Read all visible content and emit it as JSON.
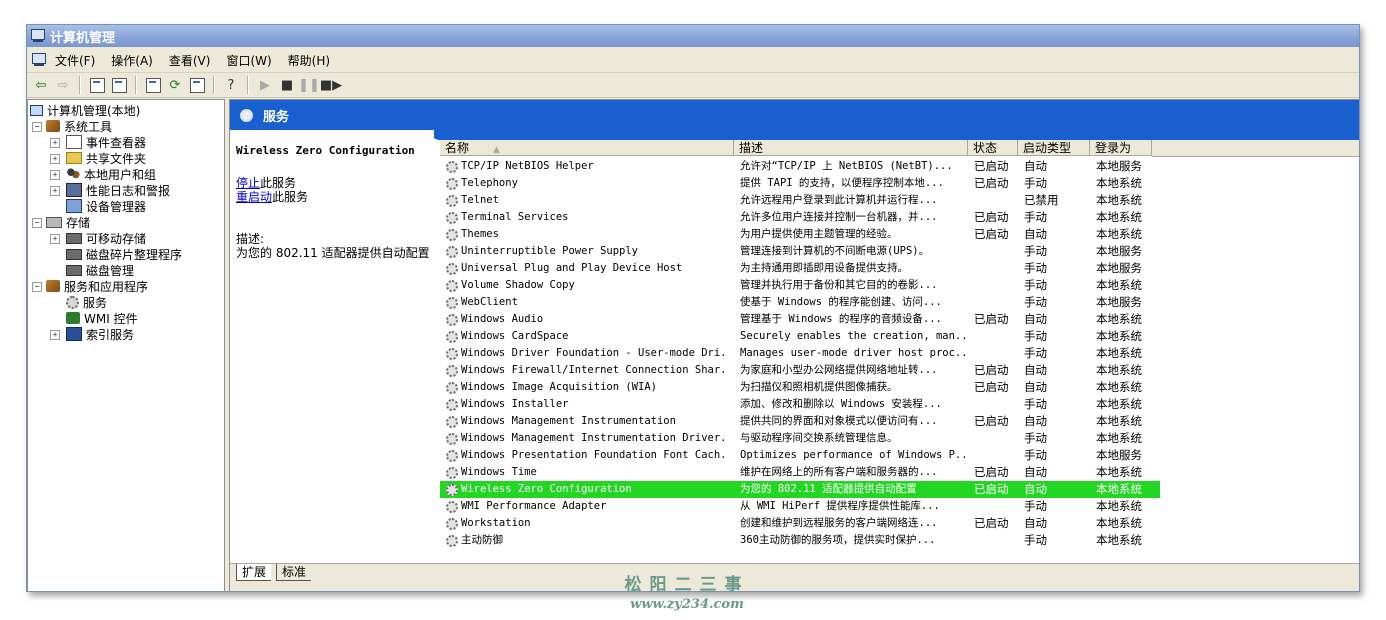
{
  "window": {
    "title": "计算机管理"
  },
  "menubar": [
    "文件(F)",
    "操作(A)",
    "查看(V)",
    "窗口(W)",
    "帮助(H)"
  ],
  "toolbar": {
    "icons": [
      "back-arrow-icon",
      "forward-arrow-icon",
      "up-folder-icon",
      "show-tree-icon",
      "properties-icon",
      "refresh-icon",
      "export-icon",
      "help-icon",
      "play-icon",
      "stop-icon",
      "pause-icon",
      "restart-icon"
    ]
  },
  "tree": {
    "root": "计算机管理(本地)",
    "system_tools": "系统工具",
    "event_viewer": "事件查看器",
    "shared_folders": "共享文件夹",
    "local_users": "本地用户和组",
    "perf_logs": "性能日志和警报",
    "device_manager": "设备管理器",
    "storage": "存储",
    "removable_storage": "可移动存储",
    "defrag": "磁盘碎片整理程序",
    "disk_mgmt": "磁盘管理",
    "services_apps": "服务和应用程序",
    "services": "服务",
    "wmi": "WMI 控件",
    "indexing": "索引服务"
  },
  "services_panel": {
    "header": "服务",
    "detail": {
      "title": "Wireless Zero Configuration",
      "stop_link": "停止",
      "stop_text": "此服务",
      "restart_link": "重启动",
      "restart_text": "此服务",
      "desc_label": "描述:",
      "desc_text": "为您的 802.11 适配器提供自动配置"
    },
    "columns": {
      "name": "名称",
      "desc": "描述",
      "status": "状态",
      "startup": "启动类型",
      "logon": "登录为"
    },
    "rows": [
      {
        "name": "TCP/IP NetBIOS Helper",
        "desc": "允许对“TCP/IP 上 NetBIOS (NetBT)...",
        "status": "已启动",
        "startup": "自动",
        "logon": "本地服务"
      },
      {
        "name": "Telephony",
        "desc": "提供 TAPI 的支持，以便程序控制本地...",
        "status": "已启动",
        "startup": "手动",
        "logon": "本地系统"
      },
      {
        "name": "Telnet",
        "desc": "允许远程用户登录到此计算机并运行程...",
        "status": "",
        "startup": "已禁用",
        "logon": "本地系统"
      },
      {
        "name": "Terminal Services",
        "desc": "允许多位用户连接并控制一台机器，并...",
        "status": "已启动",
        "startup": "手动",
        "logon": "本地系统"
      },
      {
        "name": "Themes",
        "desc": "为用户提供使用主题管理的经验。",
        "status": "已启动",
        "startup": "自动",
        "logon": "本地系统"
      },
      {
        "name": "Uninterruptible Power Supply",
        "desc": "管理连接到计算机的不间断电源(UPS)。",
        "status": "",
        "startup": "手动",
        "logon": "本地服务"
      },
      {
        "name": "Universal Plug and Play Device Host",
        "desc": "为主持通用即插即用设备提供支持。",
        "status": "",
        "startup": "手动",
        "logon": "本地服务"
      },
      {
        "name": "Volume Shadow Copy",
        "desc": "管理并执行用于备份和其它目的的卷影...",
        "status": "",
        "startup": "手动",
        "logon": "本地系统"
      },
      {
        "name": "WebClient",
        "desc": "使基于 Windows 的程序能创建、访问...",
        "status": "",
        "startup": "手动",
        "logon": "本地服务"
      },
      {
        "name": "Windows Audio",
        "desc": "管理基于 Windows 的程序的音频设备...",
        "status": "已启动",
        "startup": "自动",
        "logon": "本地系统"
      },
      {
        "name": "Windows CardSpace",
        "desc": "Securely enables the creation, man...",
        "status": "",
        "startup": "手动",
        "logon": "本地系统"
      },
      {
        "name": "Windows Driver Foundation - User-mode Dri...",
        "desc": "Manages user-mode driver host proc...",
        "status": "",
        "startup": "手动",
        "logon": "本地系统"
      },
      {
        "name": "Windows Firewall/Internet Connection Shar...",
        "desc": "为家庭和小型办公网络提供网络地址转...",
        "status": "已启动",
        "startup": "自动",
        "logon": "本地系统"
      },
      {
        "name": "Windows Image Acquisition (WIA)",
        "desc": "为扫描仪和照相机提供图像捕获。",
        "status": "已启动",
        "startup": "自动",
        "logon": "本地系统"
      },
      {
        "name": "Windows Installer",
        "desc": "添加、修改和删除以 Windows 安装程...",
        "status": "",
        "startup": "手动",
        "logon": "本地系统"
      },
      {
        "name": "Windows Management Instrumentation",
        "desc": "提供共同的界面和对象模式以便访问有...",
        "status": "已启动",
        "startup": "自动",
        "logon": "本地系统"
      },
      {
        "name": "Windows Management Instrumentation Driver...",
        "desc": "与驱动程序间交换系统管理信息。",
        "status": "",
        "startup": "手动",
        "logon": "本地系统"
      },
      {
        "name": "Windows Presentation Foundation Font Cach...",
        "desc": "Optimizes performance of Windows P...",
        "status": "",
        "startup": "手动",
        "logon": "本地服务"
      },
      {
        "name": "Windows Time",
        "desc": "维护在网络上的所有客户端和服务器的...",
        "status": "已启动",
        "startup": "自动",
        "logon": "本地系统"
      },
      {
        "name": "Wireless Zero Configuration",
        "desc": "为您的 802.11 适配器提供自动配置",
        "status": "已启动",
        "startup": "自动",
        "logon": "本地系统",
        "selected": true
      },
      {
        "name": "WMI Performance Adapter",
        "desc": "从 WMI HiPerf 提供程序提供性能库...",
        "status": "",
        "startup": "手动",
        "logon": "本地系统"
      },
      {
        "name": "Workstation",
        "desc": "创建和维护到远程服务的客户端网络连...",
        "status": "已启动",
        "startup": "自动",
        "logon": "本地系统"
      },
      {
        "name": "主动防御",
        "desc": "360主动防御的服务项，提供实时保护...",
        "status": "",
        "startup": "手动",
        "logon": "本地系统"
      }
    ],
    "tabs": [
      "扩展",
      "标准"
    ]
  },
  "watermark": {
    "line1": "松阳二三事",
    "line2": "www.zy234.com"
  },
  "colors": {
    "title_bar": "#86a2d8",
    "header_blue": "#1a5fcf",
    "selection": "#24d624"
  }
}
